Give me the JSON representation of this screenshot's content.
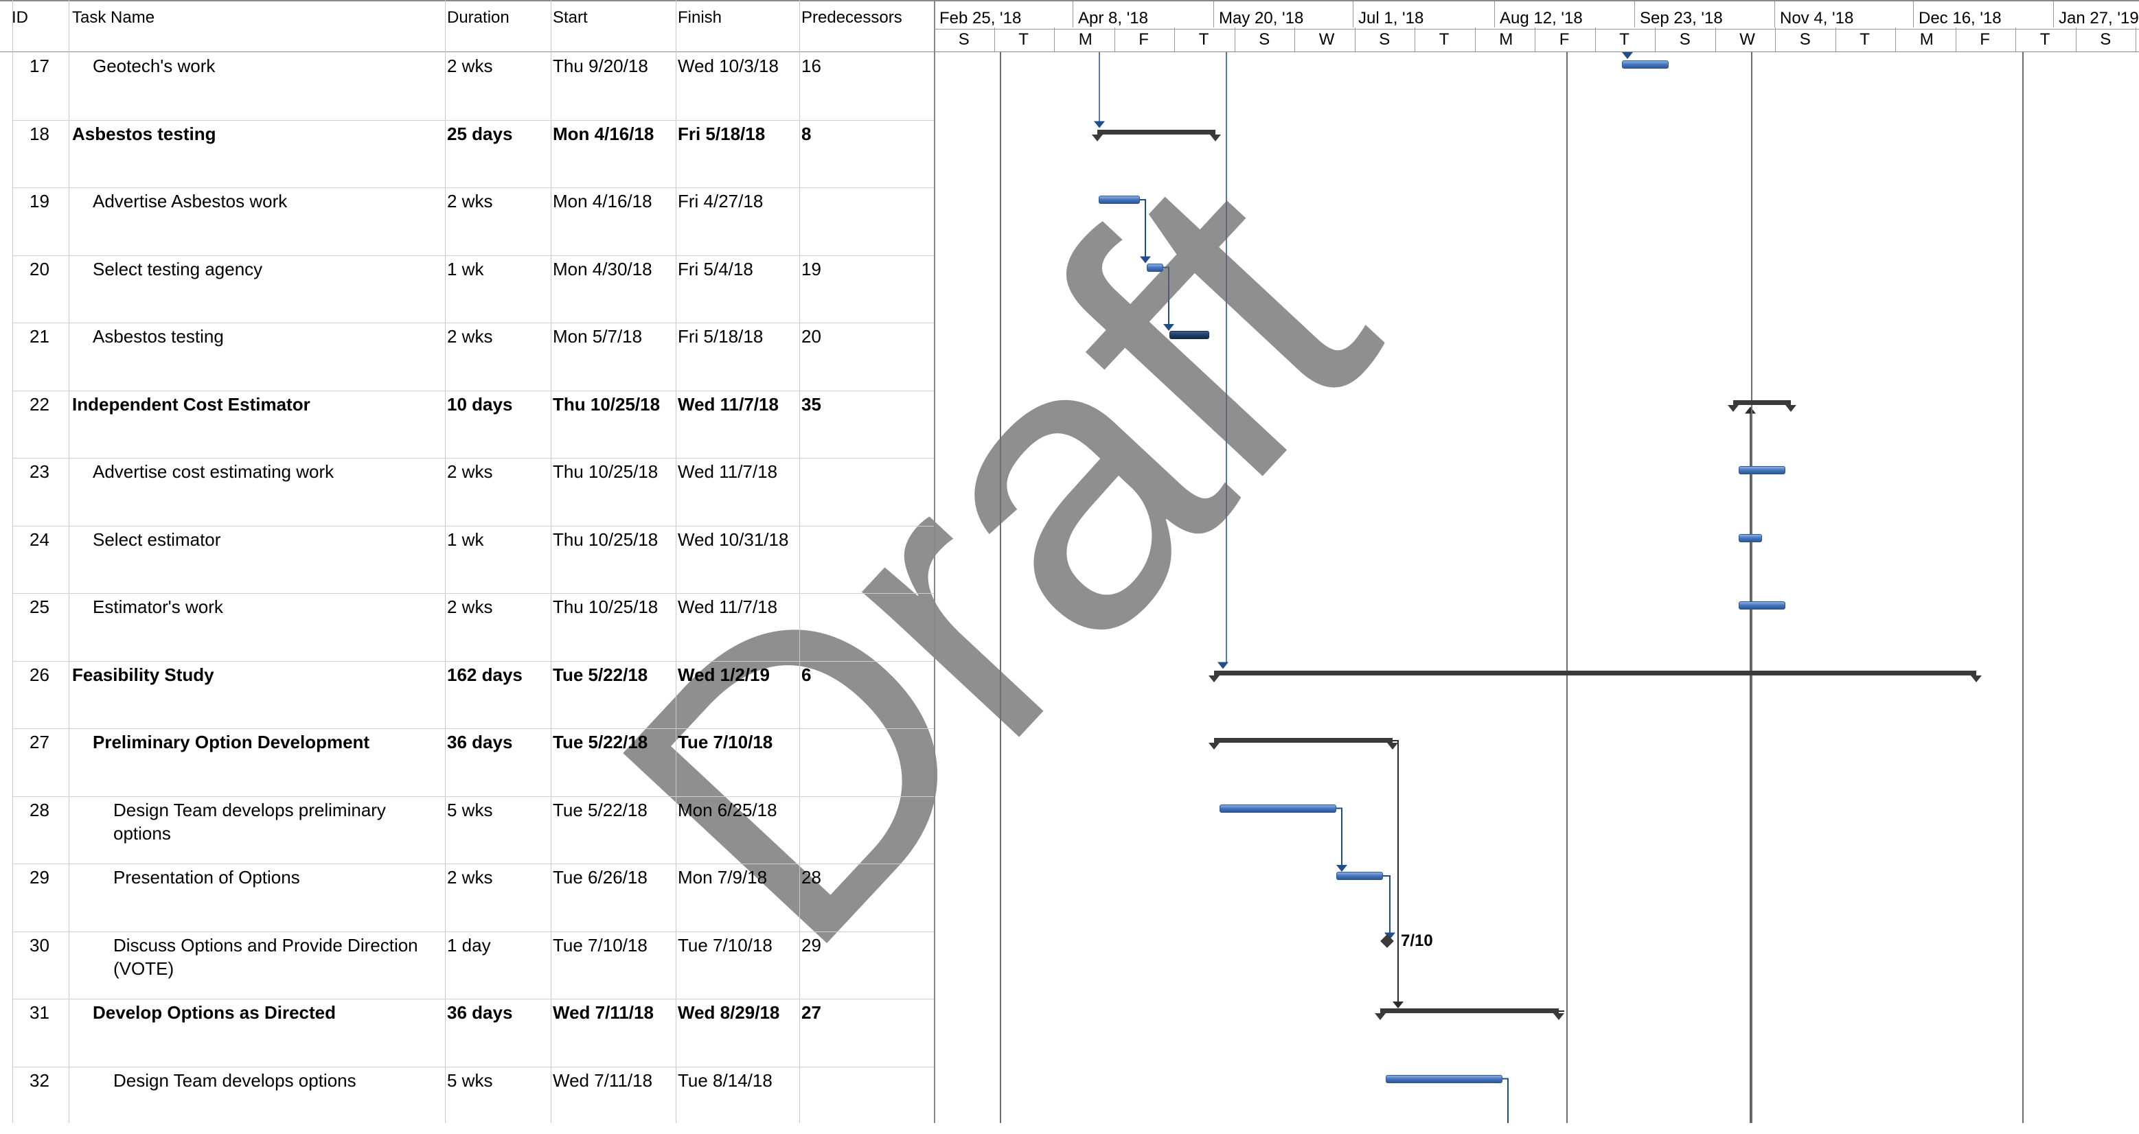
{
  "headers": {
    "id": "ID",
    "task_name": "Task Name",
    "duration": "Duration",
    "start": "Start",
    "finish": "Finish",
    "predecessors": "Predecessors"
  },
  "timescale": {
    "major": [
      "Feb 25, '18",
      "Apr 8, '18",
      "May 20, '18",
      "Jul 1, '18",
      "Aug 12, '18",
      "Sep 23, '18",
      "Nov 4, '18",
      "Dec 16, '18",
      "Jan 27, '19"
    ],
    "minor": [
      "S",
      "T",
      "M",
      "F",
      "T",
      "S",
      "W",
      "S",
      "T",
      "M",
      "F",
      "T",
      "S",
      "W",
      "S",
      "T",
      "M",
      "F",
      "T",
      "S"
    ]
  },
  "rows": [
    {
      "id": "17",
      "name": "Geotech's work",
      "duration": "2 wks",
      "start": "Thu 9/20/18",
      "finish": "Wed 10/3/18",
      "pred": "16",
      "level": 1,
      "summary": false
    },
    {
      "id": "18",
      "name": "Asbestos testing",
      "duration": "25 days",
      "start": "Mon 4/16/18",
      "finish": "Fri 5/18/18",
      "pred": "8",
      "level": 0,
      "summary": true
    },
    {
      "id": "19",
      "name": "Advertise Asbestos work",
      "duration": "2 wks",
      "start": "Mon 4/16/18",
      "finish": "Fri 4/27/18",
      "pred": "",
      "level": 1,
      "summary": false
    },
    {
      "id": "20",
      "name": "Select testing agency",
      "duration": "1 wk",
      "start": "Mon 4/30/18",
      "finish": "Fri 5/4/18",
      "pred": "19",
      "level": 1,
      "summary": false
    },
    {
      "id": "21",
      "name": "Asbestos testing",
      "duration": "2 wks",
      "start": "Mon 5/7/18",
      "finish": "Fri 5/18/18",
      "pred": "20",
      "level": 1,
      "summary": false
    },
    {
      "id": "22",
      "name": "Independent Cost Estimator",
      "duration": "10 days",
      "start": "Thu 10/25/18",
      "finish": "Wed 11/7/18",
      "pred": "35",
      "level": 0,
      "summary": true
    },
    {
      "id": "23",
      "name": "Advertise cost estimating work",
      "duration": "2 wks",
      "start": "Thu 10/25/18",
      "finish": "Wed 11/7/18",
      "pred": "",
      "level": 1,
      "summary": false
    },
    {
      "id": "24",
      "name": "Select estimator",
      "duration": "1 wk",
      "start": "Thu 10/25/18",
      "finish": "Wed 10/31/18",
      "pred": "",
      "level": 1,
      "summary": false
    },
    {
      "id": "25",
      "name": "Estimator's work",
      "duration": "2 wks",
      "start": "Thu 10/25/18",
      "finish": "Wed 11/7/18",
      "pred": "",
      "level": 1,
      "summary": false
    },
    {
      "id": "26",
      "name": "Feasibility Study",
      "duration": "162 days",
      "start": "Tue 5/22/18",
      "finish": "Wed 1/2/19",
      "pred": "6",
      "level": 0,
      "summary": true
    },
    {
      "id": "27",
      "name": "Preliminary Option Development",
      "duration": "36 days",
      "start": "Tue 5/22/18",
      "finish": "Tue 7/10/18",
      "pred": "",
      "level": 1,
      "summary": true
    },
    {
      "id": "28",
      "name": "Design Team develops preliminary",
      "name2": "options",
      "duration": "5 wks",
      "start": "Tue 5/22/18",
      "finish": "Mon 6/25/18",
      "pred": "",
      "level": 2,
      "summary": false
    },
    {
      "id": "29",
      "name": "Presentation of Options",
      "duration": "2 wks",
      "start": "Tue 6/26/18",
      "finish": "Mon 7/9/18",
      "pred": "28",
      "level": 2,
      "summary": false
    },
    {
      "id": "30",
      "name": "Discuss Options and Provide Direction",
      "name2": "(VOTE)",
      "duration": "1 day",
      "start": "Tue 7/10/18",
      "finish": "Tue 7/10/18",
      "pred": "29",
      "level": 2,
      "summary": false
    },
    {
      "id": "31",
      "name": "Develop Options as Directed",
      "duration": "36 days",
      "start": "Wed 7/11/18",
      "finish": "Wed 8/29/18",
      "pred": "27",
      "level": 1,
      "summary": true
    },
    {
      "id": "32",
      "name": "Design Team develops options",
      "duration": "5 wks",
      "start": "Wed 7/11/18",
      "finish": "Tue 8/14/18",
      "pred": "",
      "level": 2,
      "summary": false
    }
  ],
  "milestone_label": "7/10",
  "watermark": "Draft",
  "colors": {
    "task_bar": "#4a78bf",
    "critical_bar": "#203f6a",
    "summary_bar": "#3a3a3a",
    "link": "#1f4e8c"
  }
}
